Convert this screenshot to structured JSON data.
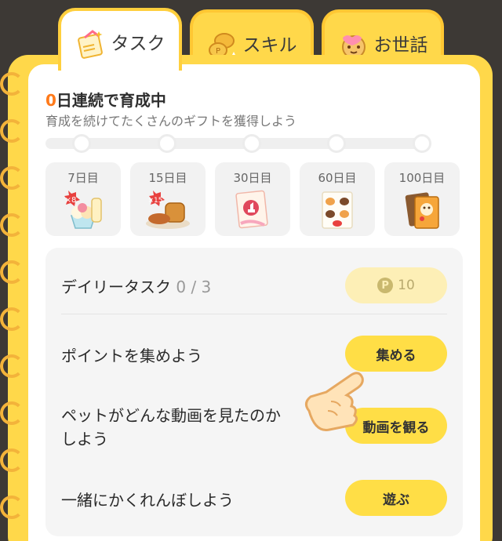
{
  "tabs": [
    {
      "label": "タスク",
      "active": true,
      "icon": "task-book-icon"
    },
    {
      "label": "スキル",
      "active": false,
      "icon": "skill-coins-icon"
    },
    {
      "label": "お世話",
      "active": false,
      "icon": "care-pet-face-icon"
    }
  ],
  "streak": {
    "count": "0",
    "title_suffix": "日連続で育成中",
    "subtitle": "育成を続けてたくさんのギフトを獲得しよう",
    "progress": 0
  },
  "rewards": [
    {
      "label": "7日目",
      "badge": "×8",
      "icon": "ice-cream-sundae-icon"
    },
    {
      "label": "15日目",
      "badge": "×15",
      "icon": "bread-dish-icon"
    },
    {
      "label": "30日目",
      "icon": "like-card-gift-icon"
    },
    {
      "label": "60日目",
      "icon": "sticker-sheet-icon"
    },
    {
      "label": "100日目",
      "icon": "photo-cards-icon"
    }
  ],
  "daily": {
    "title": "デイリータスク",
    "count": "0 / 3",
    "points": "10",
    "point_symbol": "P"
  },
  "tasks": [
    {
      "label": "ポイントを集めよう",
      "button": "集める"
    },
    {
      "label_line1": "ペットがどんな動画を見たのか",
      "label_line2": "しよう",
      "button": "動画を観る"
    },
    {
      "label": "一緒にかくれんぼしよう",
      "button": "遊ぶ"
    }
  ],
  "colors": {
    "accent_yellow": "#ffd84a",
    "streak_orange": "#ff7a1a",
    "background": "#3d3935"
  }
}
